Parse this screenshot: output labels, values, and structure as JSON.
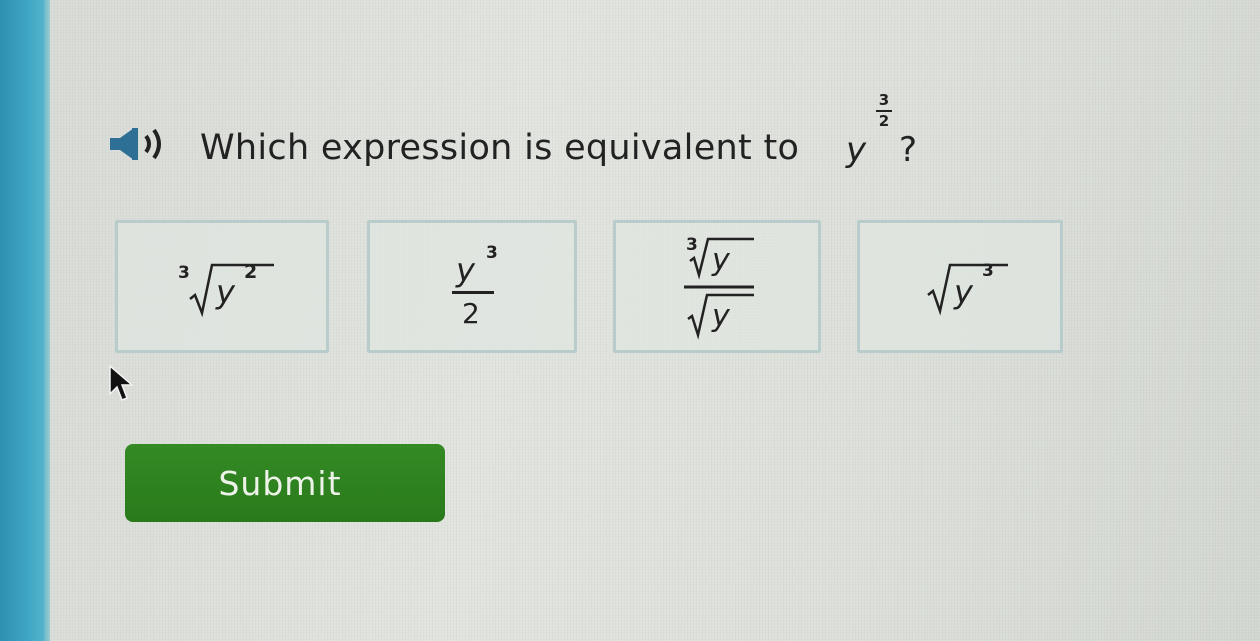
{
  "question": {
    "text": "Which expression is equivalent to",
    "base": "y",
    "exponent_numerator": "3",
    "exponent_denominator": "2",
    "end_mark": "?"
  },
  "options": [
    {
      "index": "3",
      "radicand": "y",
      "power": "2"
    },
    {
      "numerator": "y",
      "numerator_power": "3",
      "denominator": "2"
    },
    {
      "index": "3",
      "numerator_radicand": "y",
      "denominator_radicand": "y"
    },
    {
      "radicand": "y",
      "power": "3"
    }
  ],
  "submit_label": "Submit",
  "colors": {
    "accent_bar": "#3fa6c4",
    "submit_button": "#2d7f1f",
    "option_border": "#b9cccc"
  },
  "icons": [
    "speaker-icon",
    "mouse-pointer-icon"
  ]
}
